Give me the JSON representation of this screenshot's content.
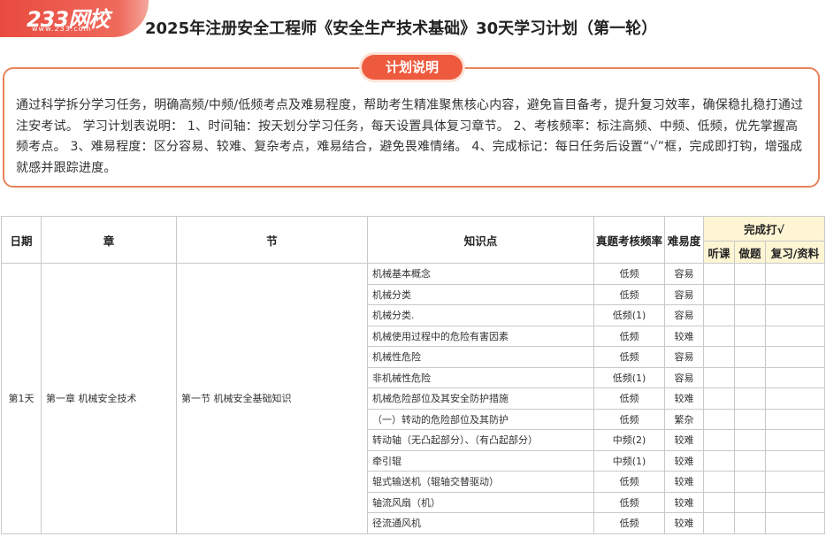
{
  "logo": {
    "main": "233网校",
    "sub": "www.233.com"
  },
  "title": "2025年注册安全工程师《安全生产技术基础》30天学习计划（第一轮）",
  "plan": {
    "tag": "计划说明",
    "text": "通过科学拆分学习任务，明确高频/中频/低频考点及难易程度，帮助考生精准聚焦核心内容，避免盲目备考，提升复习效率，确保稳扎稳打通过注安考试。 学习计划表说明： 1、时间轴：按天划分学习任务，每天设置具体复习章节。 2、考核频率：标注高频、中频、低频，优先掌握高频考点。 3、难易程度：区分容易、较难、复杂考点，难易结合，避免畏难情绪。 4、完成标记：每日任务后设置“√”框，完成即打钩，增强成就感并跟踪进度。"
  },
  "table": {
    "headers": {
      "date": "日期",
      "chapter": "章",
      "section": "节",
      "point": "知识点",
      "freq": "真题考核频率",
      "difficulty": "难易度",
      "done": "完成打√",
      "done_sub": [
        "听课",
        "做题",
        "复习/资料"
      ]
    },
    "day": "第1天",
    "chapter": "第一章 机械安全技术",
    "section": "第一节 机械安全基础知识",
    "rows": [
      {
        "point": "机械基本概念",
        "freq": "低频",
        "diff": "容易"
      },
      {
        "point": "机械分类",
        "freq": "低频",
        "diff": "容易"
      },
      {
        "point": "机械分类.",
        "freq": "低频(1)",
        "diff": "容易"
      },
      {
        "point": "机械使用过程中的危险有害因素",
        "freq": "低频",
        "diff": "较难"
      },
      {
        "point": "机械性危险",
        "freq": "低频",
        "diff": "容易"
      },
      {
        "point": "非机械性危险",
        "freq": "低频(1)",
        "diff": "容易"
      },
      {
        "point": "机械危险部位及其安全防护措施",
        "freq": "低频",
        "diff": "较难"
      },
      {
        "point": "（一）转动的危险部位及其防护",
        "freq": "低频",
        "diff": "繁杂"
      },
      {
        "point": "转动轴（无凸起部分）、（有凸起部分）",
        "freq": "中频(2)",
        "diff": "较难"
      },
      {
        "point": "牵引辊",
        "freq": "中频(1)",
        "diff": "较难"
      },
      {
        "point": "辊式输送机（辊轴交替驱动）",
        "freq": "低频",
        "diff": "较难"
      },
      {
        "point": "轴流风扇（机）",
        "freq": "低频",
        "diff": "较难"
      },
      {
        "point": "径流通风机",
        "freq": "低频",
        "diff": "较难"
      }
    ]
  }
}
